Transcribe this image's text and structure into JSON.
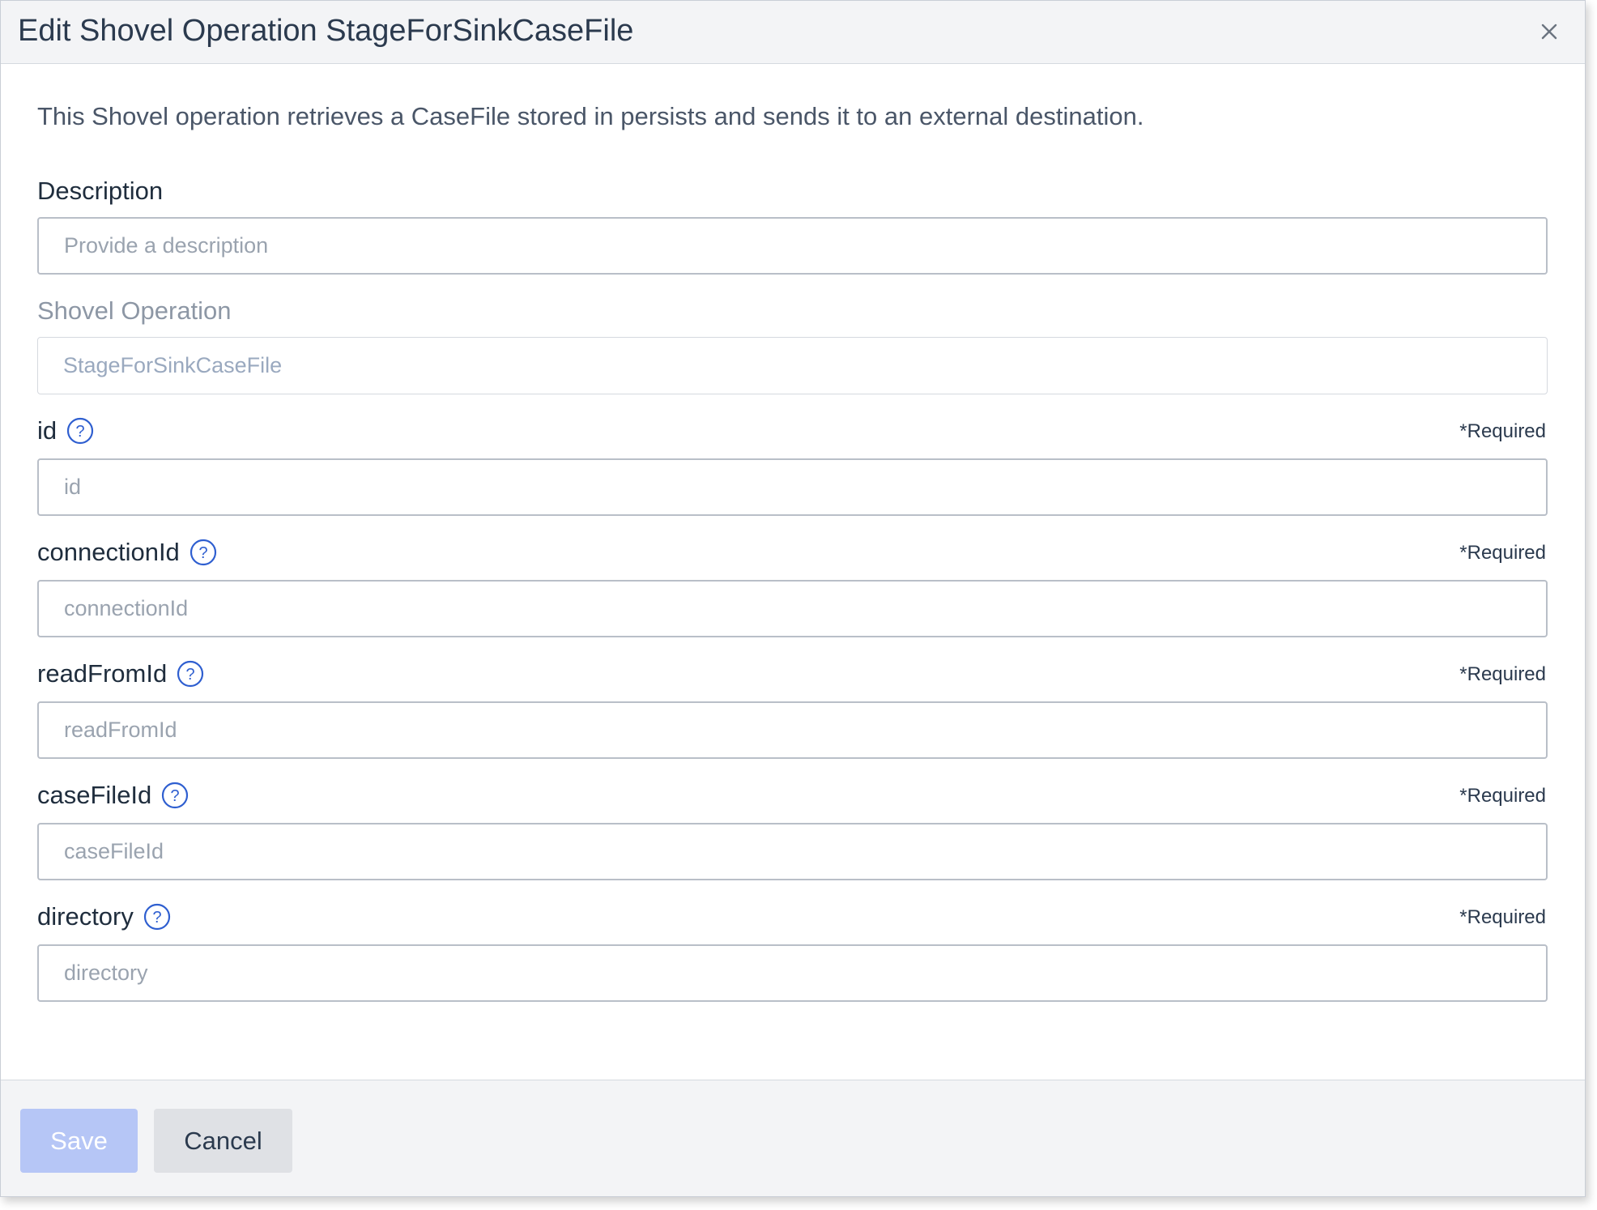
{
  "dialog": {
    "title": "Edit Shovel Operation StageForSinkCaseFile",
    "intro": "This Shovel operation retrieves a CaseFile stored in persists and sends it to an external destination."
  },
  "fields": {
    "description": {
      "label": "Description",
      "placeholder": "Provide a description",
      "value": ""
    },
    "shovel_operation": {
      "label": "Shovel Operation",
      "value": "StageForSinkCaseFile"
    },
    "id": {
      "label": "id",
      "required": "*Required",
      "placeholder": "id",
      "value": ""
    },
    "connectionId": {
      "label": "connectionId",
      "required": "*Required",
      "placeholder": "connectionId",
      "value": ""
    },
    "readFromId": {
      "label": "readFromId",
      "required": "*Required",
      "placeholder": "readFromId",
      "value": ""
    },
    "caseFileId": {
      "label": "caseFileId",
      "required": "*Required",
      "placeholder": "caseFileId",
      "value": ""
    },
    "directory": {
      "label": "directory",
      "required": "*Required",
      "placeholder": "directory",
      "value": ""
    }
  },
  "footer": {
    "save_label": "Save",
    "cancel_label": "Cancel"
  },
  "icons": {
    "help": "question-circle",
    "close": "x-mark"
  },
  "colors": {
    "accent": "#2f5fd0",
    "save_disabled_bg": "#b6c6f6",
    "cancel_bg": "#dfe1e5",
    "header_bg": "#f3f4f6"
  }
}
